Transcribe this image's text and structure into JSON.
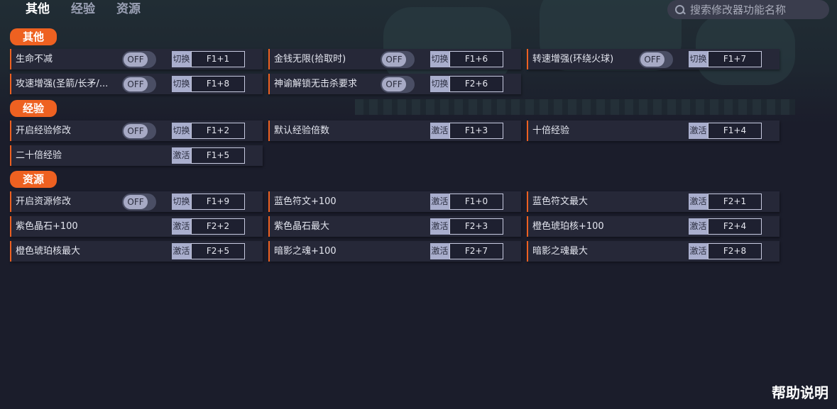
{
  "tabs": [
    {
      "label": "其他"
    },
    {
      "label": "经验"
    },
    {
      "label": "资源"
    }
  ],
  "search": {
    "placeholder": "搜索修改器功能名称"
  },
  "sections": [
    {
      "title": "其他",
      "rows": [
        [
          {
            "label": "生命不减",
            "toggle": "OFF",
            "type": "切换",
            "key": "F1+1"
          },
          {
            "label": "金钱无限(拾取时)",
            "toggle": "OFF",
            "type": "切换",
            "key": "F1+6"
          },
          {
            "label": "转速增强(环绕火球)",
            "toggle": "OFF",
            "type": "切换",
            "key": "F1+7"
          }
        ],
        [
          {
            "label": "攻速增强(圣箭/长矛/...",
            "toggle": "OFF",
            "type": "切换",
            "key": "F1+8"
          },
          {
            "label": "神谕解锁无击杀要求",
            "toggle": "OFF",
            "type": "切换",
            "key": "F2+6"
          }
        ]
      ]
    },
    {
      "title": "经验",
      "rows": [
        [
          {
            "label": "开启经验修改",
            "toggle": "OFF",
            "type": "切换",
            "key": "F1+2"
          },
          {
            "label": "默认经验倍数",
            "type": "激活",
            "key": "F1+3"
          },
          {
            "label": "十倍经验",
            "type": "激活",
            "key": "F1+4"
          }
        ],
        [
          {
            "label": "二十倍经验",
            "type": "激活",
            "key": "F1+5"
          }
        ]
      ]
    },
    {
      "title": "资源",
      "rows": [
        [
          {
            "label": "开启资源修改",
            "toggle": "OFF",
            "type": "切换",
            "key": "F1+9"
          },
          {
            "label": "蓝色符文+100",
            "type": "激活",
            "key": "F1+0"
          },
          {
            "label": "蓝色符文最大",
            "type": "激活",
            "key": "F2+1"
          }
        ],
        [
          {
            "label": "紫色晶石+100",
            "type": "激活",
            "key": "F2+2"
          },
          {
            "label": "紫色晶石最大",
            "type": "激活",
            "key": "F2+3"
          },
          {
            "label": "橙色琥珀核+100",
            "type": "激活",
            "key": "F2+4"
          }
        ],
        [
          {
            "label": "橙色琥珀核最大",
            "type": "激活",
            "key": "F2+5"
          },
          {
            "label": "暗影之魂+100",
            "type": "激活",
            "key": "F2+7"
          },
          {
            "label": "暗影之魂最大",
            "type": "激活",
            "key": "F2+8"
          }
        ]
      ]
    }
  ],
  "help": {
    "label": "帮助说明"
  },
  "colors": {
    "accent": "#ee6121",
    "background": "#1b1d2b",
    "row": "#262838"
  }
}
